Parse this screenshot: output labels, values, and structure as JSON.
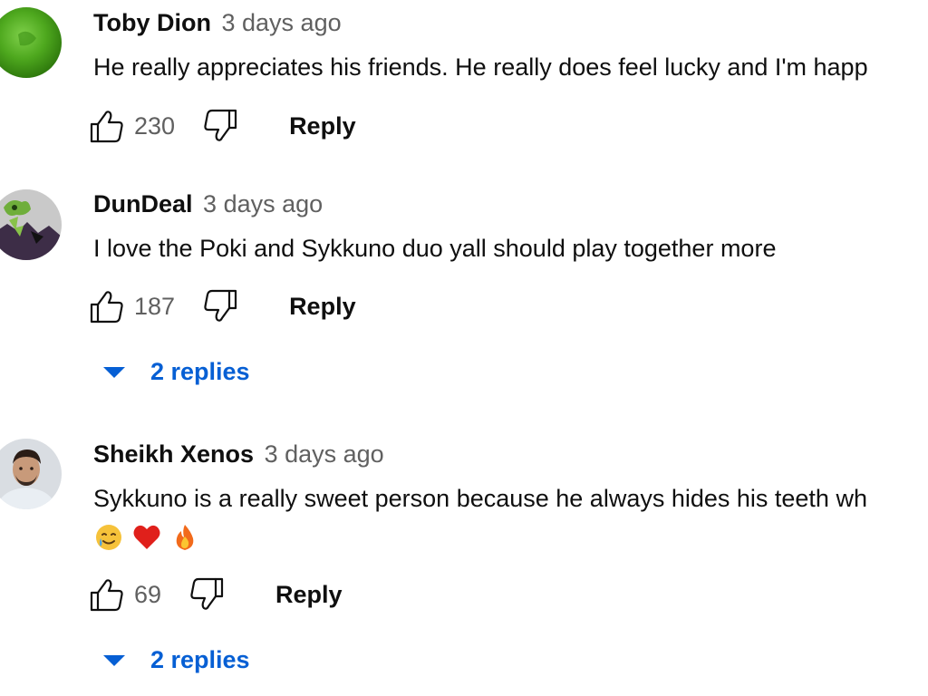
{
  "comments": [
    {
      "author": "Toby Dion",
      "time": "3 days ago",
      "text_lines": [
        "He really appreciates his friends. He really does feel lucky and I'm happ"
      ],
      "likes": "230",
      "reply_label": "Reply"
    },
    {
      "author": "DunDeal",
      "time": "3 days ago",
      "text_lines": [
        "I love the Poki and Sykkuno duo yall should play together more"
      ],
      "likes": "187",
      "reply_label": "Reply",
      "replies_label": "2 replies"
    },
    {
      "author": "Sheikh Xenos",
      "time": "3 days ago",
      "text_lines": [
        "Sykkuno is a really sweet person because he always hides his teeth wh"
      ],
      "emojis": [
        "smiling-face-with-tear-icon",
        "red-heart-icon",
        "fire-icon"
      ],
      "likes": "69",
      "reply_label": "Reply",
      "replies_label": "2 replies"
    }
  ],
  "colors": {
    "link_blue": "#065fd4",
    "secondary_text": "#606060",
    "primary_text": "#0f0f0f"
  }
}
